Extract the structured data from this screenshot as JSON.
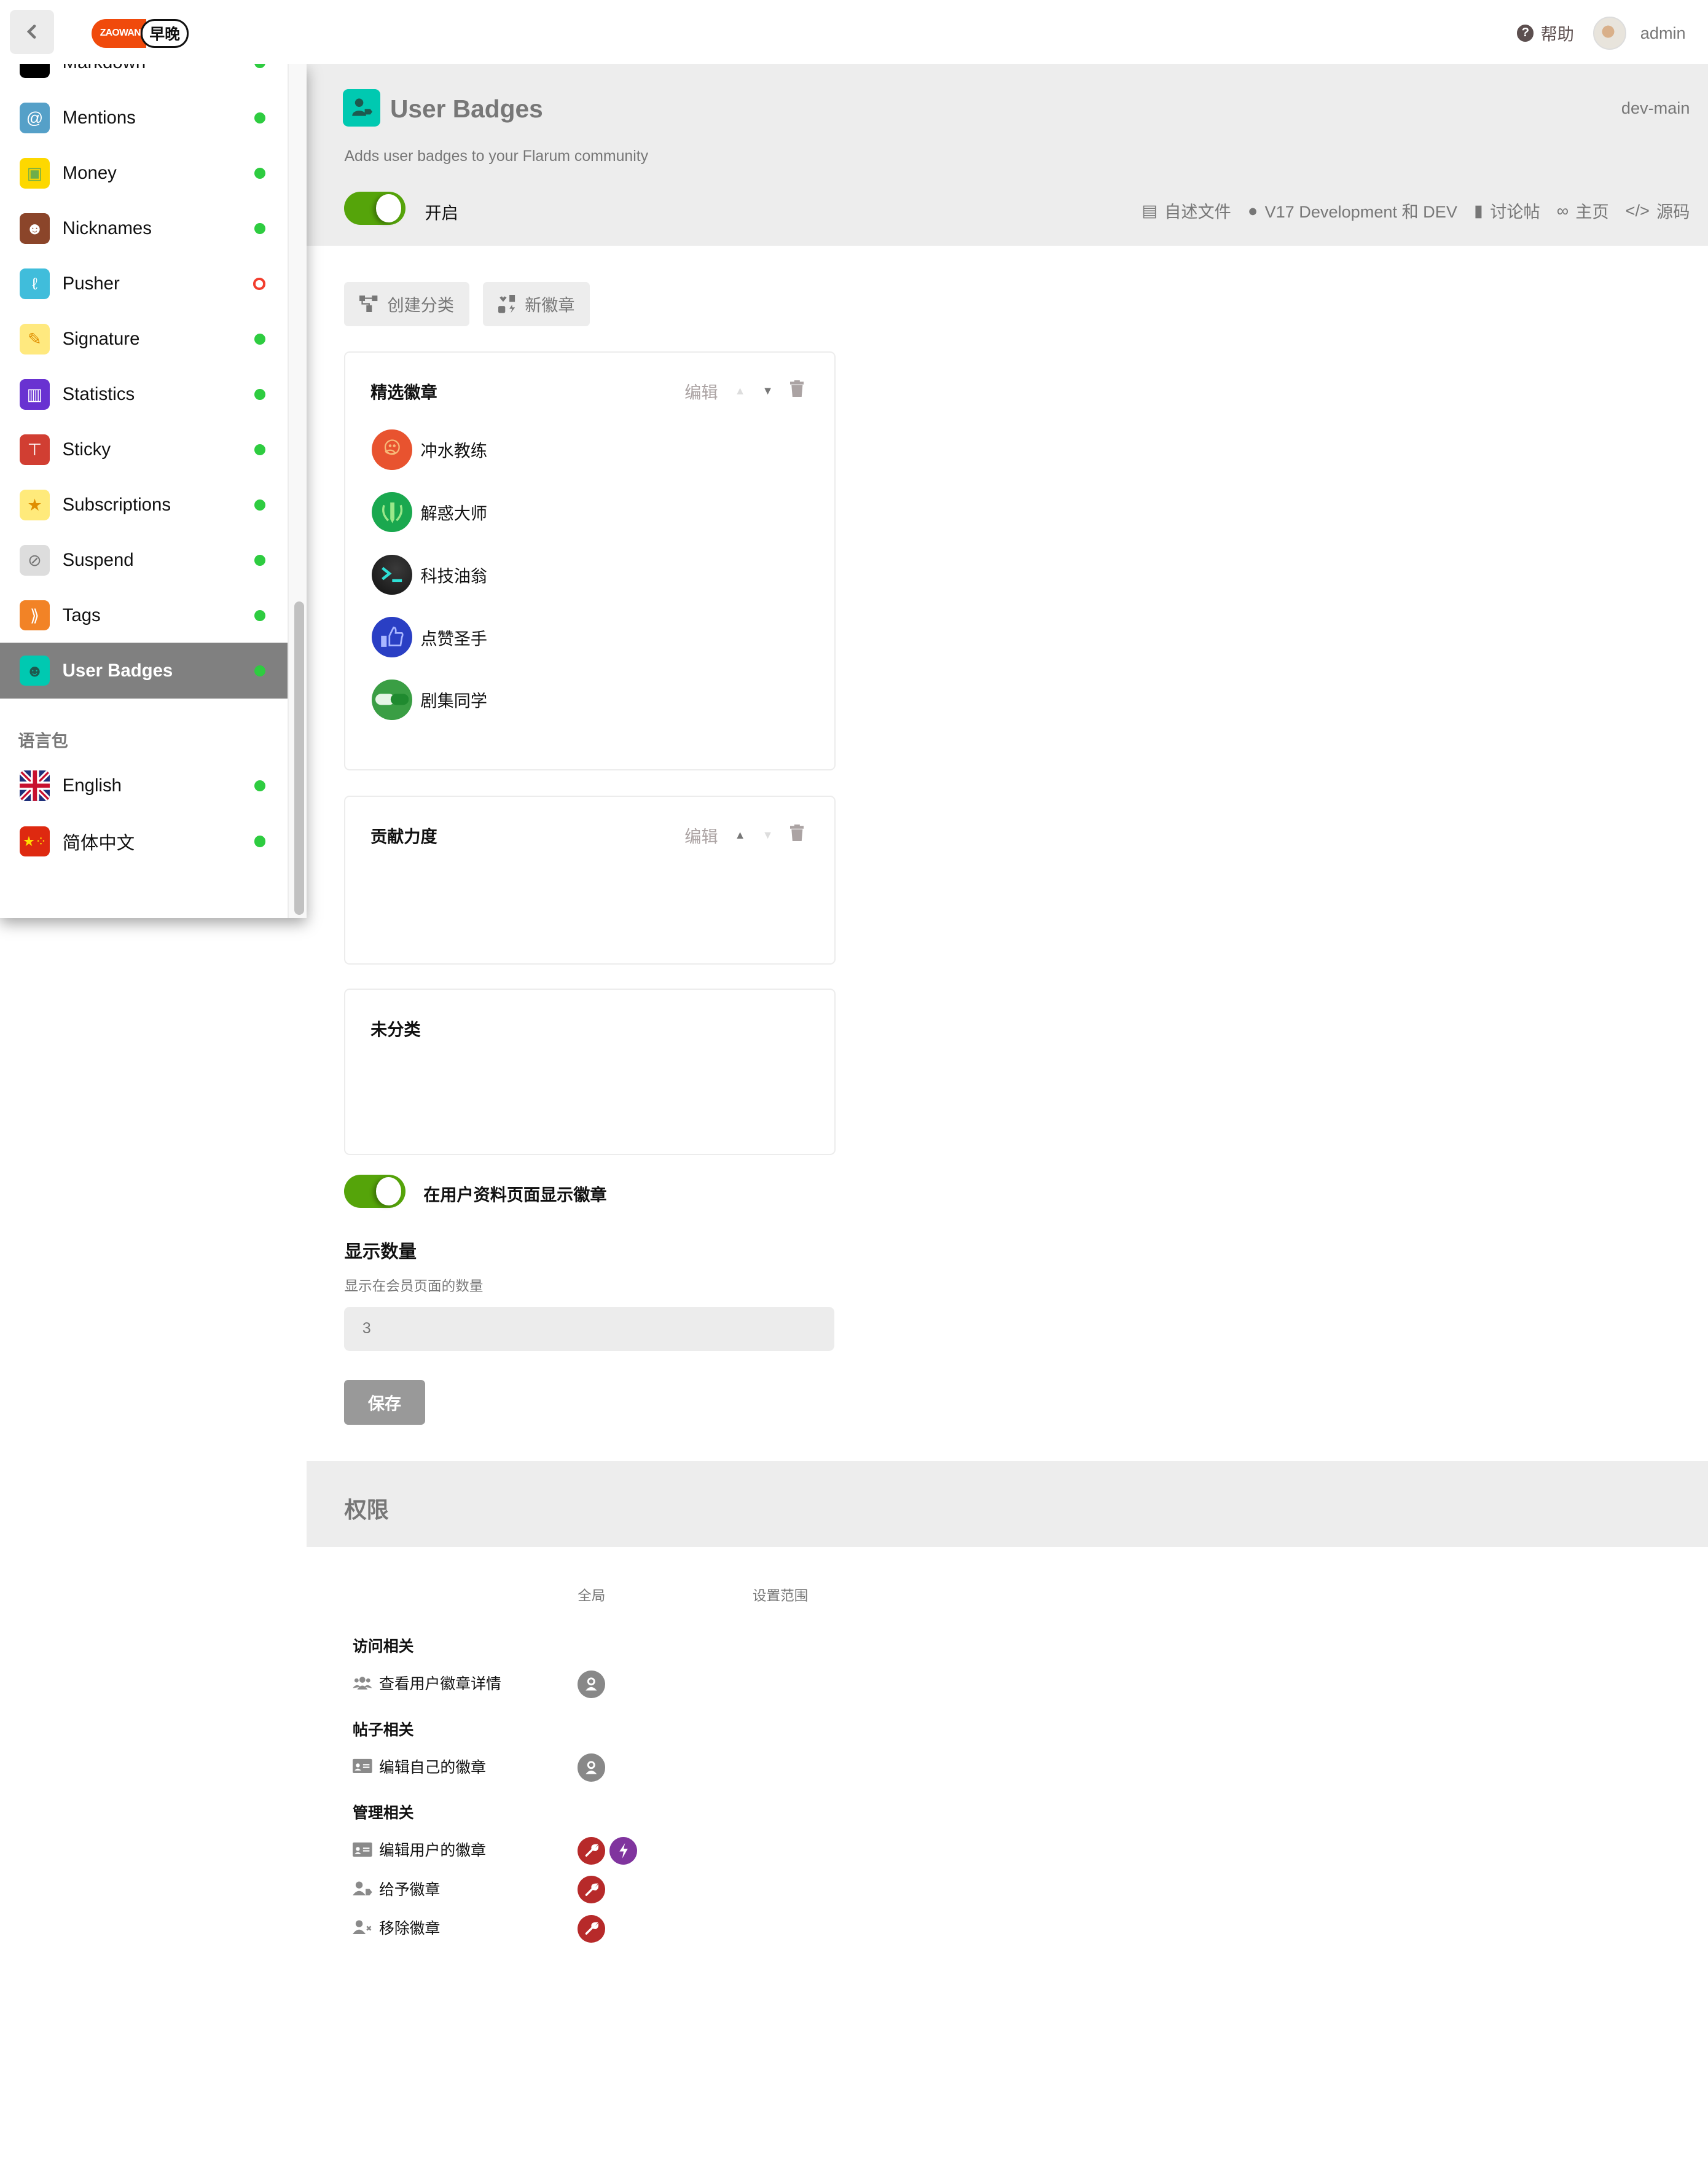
{
  "header": {
    "back_label": "‹",
    "logo_left": "ZAOWAN",
    "logo_right": "早晚",
    "help_label": "帮助",
    "help_icon": "?",
    "username": "admin"
  },
  "sidebar": {
    "partial_item": {
      "label": "Markdown",
      "status": "enabled",
      "icon": "markdown-icon",
      "color": "#000000"
    },
    "items": [
      {
        "label": "Mentions",
        "status": "enabled",
        "icon": "at-icon",
        "glyph": "@",
        "color": "#55a0c8"
      },
      {
        "label": "Money",
        "status": "enabled",
        "icon": "money-icon",
        "glyph": "▣",
        "color": "#fdd800"
      },
      {
        "label": "Nicknames",
        "status": "enabled",
        "icon": "user-tag-icon",
        "glyph": "☻",
        "color": "#8b452a"
      },
      {
        "label": "Pusher",
        "status": "disabled",
        "icon": "pusher-icon",
        "glyph": "ℓ",
        "color": "#40bddb"
      },
      {
        "label": "Signature",
        "status": "enabled",
        "icon": "signature-icon",
        "glyph": "✎",
        "color": "#ffe97f"
      },
      {
        "label": "Statistics",
        "status": "enabled",
        "icon": "chart-icon",
        "glyph": "▥",
        "color": "#6932d1"
      },
      {
        "label": "Sticky",
        "status": "enabled",
        "icon": "thumbtack-icon",
        "glyph": "⊤",
        "color": "#d13e32"
      },
      {
        "label": "Subscriptions",
        "status": "enabled",
        "icon": "star-icon",
        "glyph": "★",
        "color": "#ffea7b"
      },
      {
        "label": "Suspend",
        "status": "enabled",
        "icon": "ban-icon",
        "glyph": "⊘",
        "color": "#dddddd"
      },
      {
        "label": "Tags",
        "status": "enabled",
        "icon": "tags-icon",
        "glyph": "⟫",
        "color": "#f28326"
      },
      {
        "label": "User Badges",
        "status": "enabled",
        "icon": "user-badge-icon",
        "glyph": "☻",
        "color": "#00c9b1",
        "active": true
      }
    ],
    "language_section": "语言包",
    "languages": [
      {
        "label": "English",
        "status": "enabled",
        "icon": "uk-flag-icon"
      },
      {
        "label": "简体中文",
        "status": "enabled",
        "icon": "china-flag-icon"
      }
    ]
  },
  "extension": {
    "title": "User Badges",
    "version": "dev-main",
    "description": "Adds user badges to your Flarum community",
    "enabled": true,
    "enabled_label": "开启",
    "links": [
      {
        "label": "自述文件",
        "icon": "book-icon",
        "glyph": "▤"
      },
      {
        "label": "V17 Development 和 DEV",
        "icon": "user-icon",
        "glyph": "●"
      },
      {
        "label": "讨论帖",
        "icon": "comment-icon",
        "glyph": "▮"
      },
      {
        "label": "主页",
        "icon": "link-icon",
        "glyph": "∞"
      },
      {
        "label": "源码",
        "icon": "code-icon",
        "glyph": "</>"
      }
    ],
    "accent_color": "#55a40a"
  },
  "actions": {
    "create_category": "创建分类",
    "new_badge": "新徽章"
  },
  "categories": [
    {
      "title": "精选徽章",
      "edit_label": "编辑",
      "can_move_up": false,
      "can_move_down": true,
      "badges": [
        {
          "name": "冲水教练",
          "color": "#e8532f",
          "icon": "duck-icon",
          "glyph": "🦆"
        },
        {
          "name": "解惑大师",
          "color": "#1aa84f",
          "icon": "laurel-pencil-icon",
          "glyph": "✎"
        },
        {
          "name": "科技油翁",
          "color": "#1e1e1e",
          "icon": "terminal-icon",
          "glyph": ">_"
        },
        {
          "name": "点赞圣手",
          "color": "#2a3fc4",
          "icon": "thumbs-up-icon",
          "glyph": "👍"
        },
        {
          "name": "剧集同学",
          "color": "#3a9e44",
          "icon": "zaowan-logo-icon",
          "glyph": "早"
        }
      ]
    },
    {
      "title": "贡献力度",
      "edit_label": "编辑",
      "can_move_up": true,
      "can_move_down": false,
      "badges": []
    },
    {
      "title": "未分类",
      "badges": []
    }
  ],
  "settings": {
    "show_on_profile": true,
    "show_on_profile_label": "在用户资料页面显示徽章",
    "count_label": "显示数量",
    "count_help": "显示在会员页面的数量",
    "count_value": "3",
    "save_label": "保存"
  },
  "permissions": {
    "title": "权限",
    "columns": [
      "全局",
      "设置范围"
    ],
    "groups": [
      {
        "title": "访问相关",
        "rows": [
          {
            "label": "查看用户徽章详情",
            "icon": "users-icon",
            "glyph": "👥",
            "roles": [
              {
                "name": "members",
                "color": "#888888",
                "glyph": "👤"
              }
            ]
          }
        ]
      },
      {
        "title": "帖子相关",
        "rows": [
          {
            "label": "编辑自己的徽章",
            "icon": "id-card-icon",
            "glyph": "▭",
            "roles": [
              {
                "name": "members",
                "color": "#888888",
                "glyph": "👤"
              }
            ]
          }
        ]
      },
      {
        "title": "管理相关",
        "rows": [
          {
            "label": "编辑用户的徽章",
            "icon": "id-card-icon",
            "glyph": "▭",
            "roles": [
              {
                "name": "admins",
                "color": "#b72a2a",
                "glyph": "🔧"
              },
              {
                "name": "mods",
                "color": "#80349e",
                "glyph": "⚡"
              }
            ]
          },
          {
            "label": "给予徽章",
            "icon": "user-tag-icon",
            "glyph": "👤",
            "roles": [
              {
                "name": "admins",
                "color": "#b72a2a",
                "glyph": "🔧"
              }
            ]
          },
          {
            "label": "移除徽章",
            "icon": "user-times-icon",
            "glyph": "👤",
            "roles": [
              {
                "name": "admins",
                "color": "#b72a2a",
                "glyph": "🔧"
              }
            ]
          }
        ]
      }
    ]
  }
}
